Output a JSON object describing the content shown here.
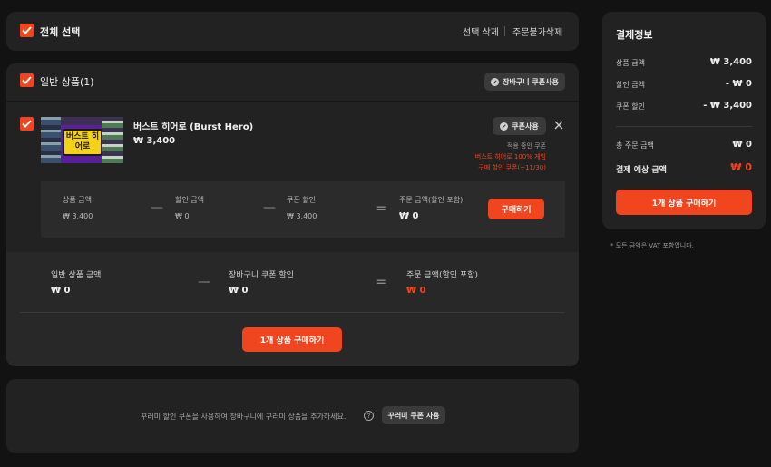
{
  "select_bar": {
    "select_all_label": "전체 선택",
    "delete_selected": "선택 삭제",
    "delete_unorderable": "주문불가삭제"
  },
  "general_section": {
    "title": "일반 상품(1)",
    "cart_coupon_button": "장바구니 쿠폰사용"
  },
  "product": {
    "name": "버스트 히어로 (Burst Hero)",
    "price": "₩ 3,400",
    "thumbnail_text": "버스트 히어로",
    "coupon_button": "쿠폰사용",
    "applied_coupon_label": "적용 중인 쿠폰",
    "applied_coupon_line1": "버스트 히어로 100% 게임",
    "applied_coupon_line2": "구매 할인 쿠폰(~11/30)",
    "summary": {
      "product_amount_label": "상품 금액",
      "product_amount_value": "₩ 3,400",
      "discount_label": "할인 금액",
      "discount_value": "₩ 0",
      "coupon_discount_label": "쿠폰 할인",
      "coupon_discount_value": "₩ 3,400",
      "order_amount_label": "주문 금액(할인 포함)",
      "order_amount_value": "₩ 0",
      "buy_button": "구매하기"
    }
  },
  "section_total": {
    "general_amount_label": "일반 상품 금액",
    "general_amount_value": "₩ 0",
    "cart_coupon_discount_label": "장바구니 쿠폰 할인",
    "cart_coupon_discount_value": "₩ 0",
    "order_amount_label": "주문 금액(할인 포함)",
    "order_amount_value": "₩ 0",
    "buy_button": "1개 상품 구매하기"
  },
  "kkurimi": {
    "message": "꾸러미 할인 쿠폰을 사용하여 장바구니에 꾸러미 상품을 추가하세요.",
    "help_icon": "?",
    "button": "꾸러미 쿠폰 사용"
  },
  "payment_info": {
    "title": "결제정보",
    "product_amount_label": "상품 금액",
    "product_amount_value": "₩ 3,400",
    "discount_label": "할인 금액",
    "discount_value": "- ₩ 0",
    "coupon_discount_label": "쿠폰 할인",
    "coupon_discount_value": "- ₩ 3,400",
    "total_order_label": "총 주문 금액",
    "total_order_value": "₩ 0",
    "expected_payment_label": "결제 예상 금액",
    "expected_payment_value": "₩ 0",
    "buy_button": "1개 상품 구매하기",
    "vat_note": "* 모든 금액은 VAT 포함입니다."
  },
  "colors": {
    "accent": "#f1451f",
    "panel": "#222222",
    "background": "#121212"
  }
}
